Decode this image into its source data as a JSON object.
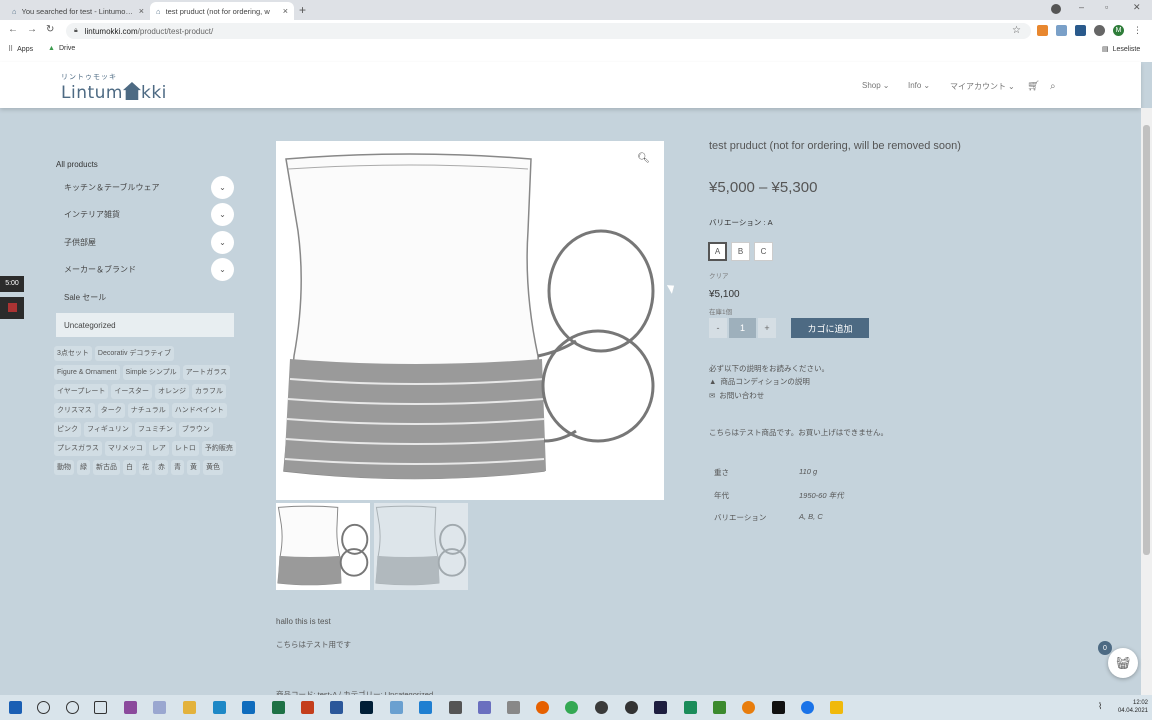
{
  "browser": {
    "tabs": [
      {
        "title": "You searched for test - Lintumokki"
      },
      {
        "title": "test pruduct (not for ordering, w"
      }
    ],
    "url_host": "lintumokki.com",
    "url_path": "/product/test-product/",
    "bookmarks": [
      {
        "label": "Apps"
      },
      {
        "label": "Drive"
      }
    ],
    "reading_list": "Leseliste",
    "profile_initial": "M"
  },
  "site": {
    "logo_kana": "リントゥモッキ",
    "logo_left": "Lintum",
    "logo_right": "kki",
    "menu": [
      {
        "label": "Shop"
      },
      {
        "label": "Info"
      },
      {
        "label": "マイアカウント"
      }
    ]
  },
  "sidebar": {
    "title": "All products",
    "categories": [
      {
        "label": "キッチン＆テーブルウェア"
      },
      {
        "label": "インテリア雑貨"
      },
      {
        "label": "子供部屋"
      },
      {
        "label": "メーカー＆ブランド"
      },
      {
        "label": "Sale セール"
      },
      {
        "label": "Uncategorized"
      }
    ],
    "tags": [
      "3点セット",
      "Decorativ デコラティブ",
      "Figure & Ornament",
      "Simple シンプル",
      "アートガラス",
      "イヤープレート",
      "イースター",
      "オレンジ",
      "カラフル",
      "クリスマス",
      "ターク",
      "ナチュラル",
      "ハンドペイント",
      "ピンク",
      "フィギュリン",
      "フュミチン",
      "ブラウン",
      "プレスガラス",
      "マリメッコ",
      "レア",
      "レトロ",
      "予約販売",
      "動物",
      "緑",
      "新古品",
      "白",
      "花",
      "赤",
      "青",
      "黄",
      "黄色"
    ],
    "widget_time": "5:00"
  },
  "product": {
    "title": "test pruduct (not for ordering, will be removed soon)",
    "price_range": "¥5,000 – ¥5,300",
    "variation_label": "バリエーション : A",
    "variations": [
      "A",
      "B",
      "C"
    ],
    "variation_desc": "クリア",
    "price": "¥5,100",
    "stock": "在庫1個",
    "qty_minus": "-",
    "qty": "1",
    "qty_plus": "+",
    "add_to_cart": "カゴに追加",
    "notice": "必ず以下の説明をお読みください。",
    "condition_link": "商品コンディションの説明",
    "contact_link": "お問い合わせ",
    "test_note": "こちらはテスト商品です。お買い上げはできません。",
    "attributes": [
      {
        "name": "重さ",
        "value": "110 g"
      },
      {
        "name": "年代",
        "value": "1950-60 年代"
      },
      {
        "name": "バリエーション",
        "value": "A, B, C"
      }
    ],
    "desc_line1": "hallo this is test",
    "desc_line2": "こちらはテスト用です",
    "meta_line": "商品コード: test-A / カテゴリー: Uncategorized"
  },
  "cart": {
    "count": "0"
  },
  "taskbar": {
    "time": "12:02",
    "date": "04.04.2021"
  },
  "colors": {
    "page_bg": "#c5d3dc",
    "accent": "#4d6a83"
  }
}
